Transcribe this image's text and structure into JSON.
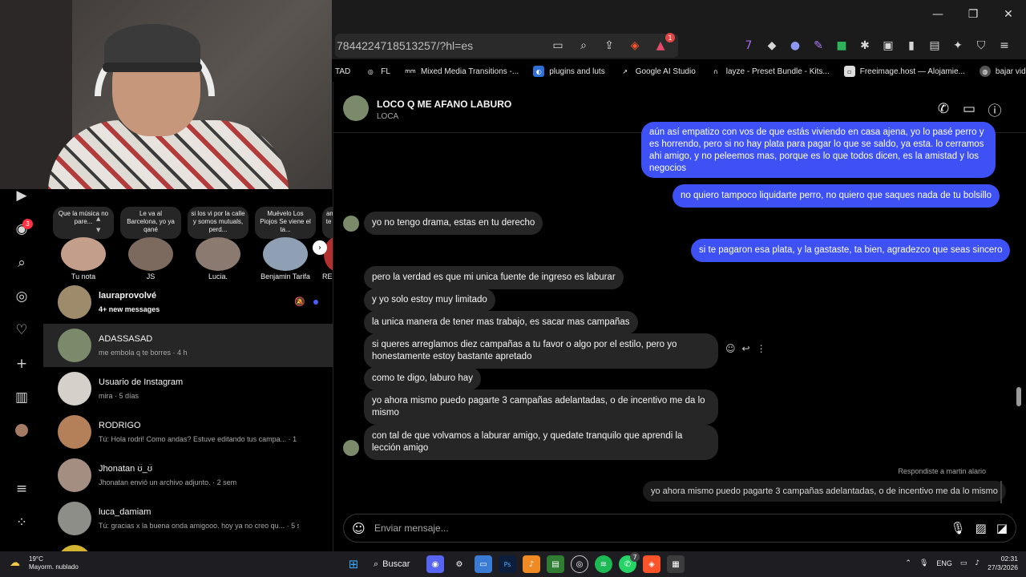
{
  "window": {
    "minimize": "—",
    "maximize": "❐",
    "close": "✕"
  },
  "address": {
    "url": "7844224718513257/?hl=es"
  },
  "bookmarks": [
    {
      "label": "TAD"
    },
    {
      "label": "FL"
    },
    {
      "label": "Mixed Media Transitions -..."
    },
    {
      "label": "plugins and luts"
    },
    {
      "label": "Google AI Studio"
    },
    {
      "label": "layze - Preset Bundle - Kits..."
    },
    {
      "label": "Freeimage.host — Alojamie..."
    },
    {
      "label": "bajar vidios"
    }
  ],
  "toolbar_badge": "1",
  "rail": {
    "notif_count": "3"
  },
  "notes": [
    {
      "text": "Que la música no pare...",
      "name": "Tu nota"
    },
    {
      "text": "Le va al Barcelona, yo ya qané",
      "name": "JS"
    },
    {
      "text": "si los vi por la calle y somos mutuals, perd...",
      "name": "Lucia."
    },
    {
      "text": "Muévelo Los Piojos Se viene el ta...",
      "name": "Benjamin Tarifa"
    },
    {
      "text": "amo la te amo",
      "name": "REGISTER"
    }
  ],
  "conversations": [
    {
      "name": "lauraprovolvé",
      "sub": "4+ new messages"
    },
    {
      "name": "ADASSASAD",
      "sub": "me embola q te borres · 4 h"
    },
    {
      "name": "Usuario de Instagram",
      "sub": "mira · 5 días"
    },
    {
      "name": "RODRIGO",
      "sub": "Tú: Hola rodri! Como andas? Estuve editando tus campa... · 1 sem"
    },
    {
      "name": "Jhonatan ʊ̈_ʊ̈",
      "sub": "Jhonatan envió un archivo adjunto. · 2 sem"
    },
    {
      "name": "luca_damiam",
      "sub": "Tú: gracias x la buena onda amigooo. hoy ya no creo qu... · 5 sem"
    }
  ],
  "chat": {
    "name": "LOCO Q ME AFANO LABURO",
    "sub": "LOCA",
    "messages": [
      "aún así empatizo con vos de que estás viviendo en casa ajena, yo lo pasé perro y es horrendo, pero si no hay plata para pagar lo que se saldo, ya esta. lo cerramos ahi amigo, y no peleemos mas, porque es lo que todos dicen, es la amistad y los negocios",
      "no quiero tampoco liquidarte perro, no quiero que saques nada de tu bolsillo",
      "yo no tengo drama, estas en tu derecho",
      "si te pagaron esa plata, y la gastaste, ta bien, agradezco que seas sincero",
      "pero la verdad es que mi unica fuente de ingreso es laburar",
      "y yo solo estoy muy limitado",
      "la unica manera de tener mas trabajo, es sacar mas campañas",
      "si queres arreglamos diez campañas a tu favor o algo por el estilo, pero yo honestamente estoy bastante apretado",
      "como te digo, laburo hay",
      "yo ahora mismo puedo pagarte 3 campañas adelantadas, o de incentivo me da lo mismo",
      "con tal de que volvamos a laburar amigo, y quedate tranquilo que aprendi la lección amigo"
    ],
    "reply_label": "Respondiste a martin alario",
    "reply_quote": "yo ahora mismo puedo pagarte 3 campañas adelantadas, o de incentivo me da lo mismo",
    "composer_placeholder": "Enviar mensaje..."
  },
  "taskbar": {
    "temp": "19°C",
    "weather": "Mayorm. nublado",
    "search": "Buscar",
    "whatsapp_badge": "7",
    "lang": "ENG",
    "time": "02:31",
    "date": "27/3/2026"
  },
  "colors": {
    "sent": "#3d51f5",
    "received": "#262626",
    "unread_dot": "#4a5df9"
  }
}
